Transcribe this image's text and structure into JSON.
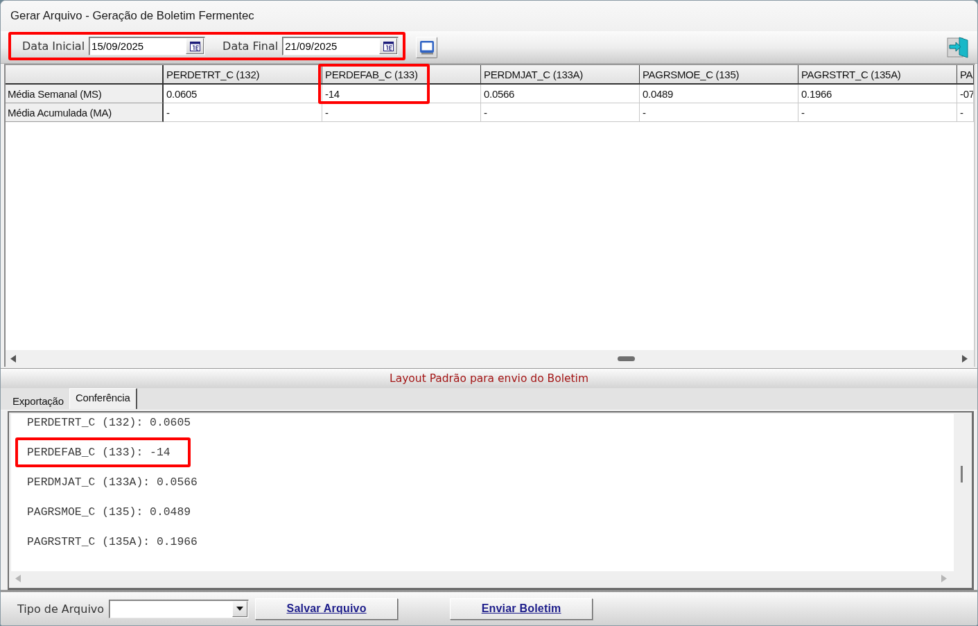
{
  "window": {
    "title": "Gerar Arquivo - Geração de Boletim Fermentec"
  },
  "toolbar": {
    "date_filter": {
      "highlighted": true,
      "fields": [
        {
          "label": "Data Inicial",
          "value": "15/09/2025"
        },
        {
          "label": "Data Final",
          "value": "21/09/2025"
        }
      ]
    }
  },
  "table": {
    "columns": [
      {
        "label": "PERDETRT_C (132)",
        "highlighted": false
      },
      {
        "label": "PERDEFAB_C (133)",
        "highlighted": true
      },
      {
        "label": "PERDMJAT_C (133A)",
        "highlighted": false
      },
      {
        "label": "PAGRSMOE_C (135)",
        "highlighted": false
      },
      {
        "label": "PAGRSTRT_C (135A)",
        "highlighted": false
      },
      {
        "label": "PA",
        "highlighted": false
      }
    ],
    "rows": [
      {
        "label": "Média Semanal (MS)",
        "cells": [
          "0.0605",
          "-14",
          "0.0566",
          "0.0489",
          "0.1966",
          "-07"
        ]
      },
      {
        "label": "Média Acumulada (MA)",
        "cells": [
          "-",
          "-",
          "-",
          "-",
          "-",
          "-"
        ]
      }
    ]
  },
  "banner": {
    "text": "Layout Padrão para envio do Boletim"
  },
  "tabs": [
    {
      "label": "Exportação",
      "selected": false
    },
    {
      "label": "Conferência",
      "selected": true
    }
  ],
  "conference_lines": [
    {
      "text": "PERDETRT_C (132): 0.0605",
      "highlighted": false
    },
    {
      "text": "PERDEFAB_C (133): -14",
      "highlighted": true
    },
    {
      "text": "PERDMJAT_C (133A): 0.0566",
      "highlighted": false
    },
    {
      "text": "PAGRSMOE_C (135): 0.0489",
      "highlighted": false
    },
    {
      "text": "PAGRSTRT_C (135A): 0.1966",
      "highlighted": false
    }
  ],
  "footer": {
    "file_type": {
      "label": "Tipo de Arquivo"
    },
    "buttons": [
      {
        "label": "Salvar Arquivo"
      },
      {
        "label": "Enviar Boletim"
      }
    ]
  }
}
